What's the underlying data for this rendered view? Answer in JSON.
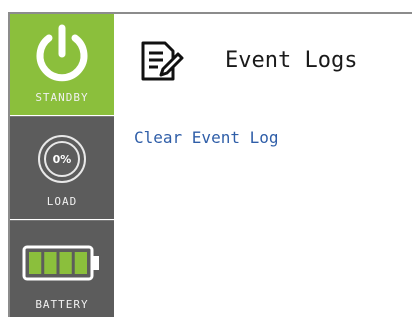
{
  "sidebar": {
    "standby": {
      "label": "STANDBY",
      "icon": "power-icon",
      "color": "#8bbf3c"
    },
    "load": {
      "label": "LOAD",
      "icon": "load-gauge-icon",
      "percent_text": "0%",
      "value": 0
    },
    "battery": {
      "label": "BATTERY",
      "icon": "battery-icon",
      "charge_bars_filled": 4,
      "charge_bars_total": 4
    }
  },
  "header": {
    "title": "Event Logs",
    "icon": "document-edit-icon"
  },
  "main": {
    "clear_link": "Clear Event Log",
    "link_color": "#2f5ea8"
  }
}
